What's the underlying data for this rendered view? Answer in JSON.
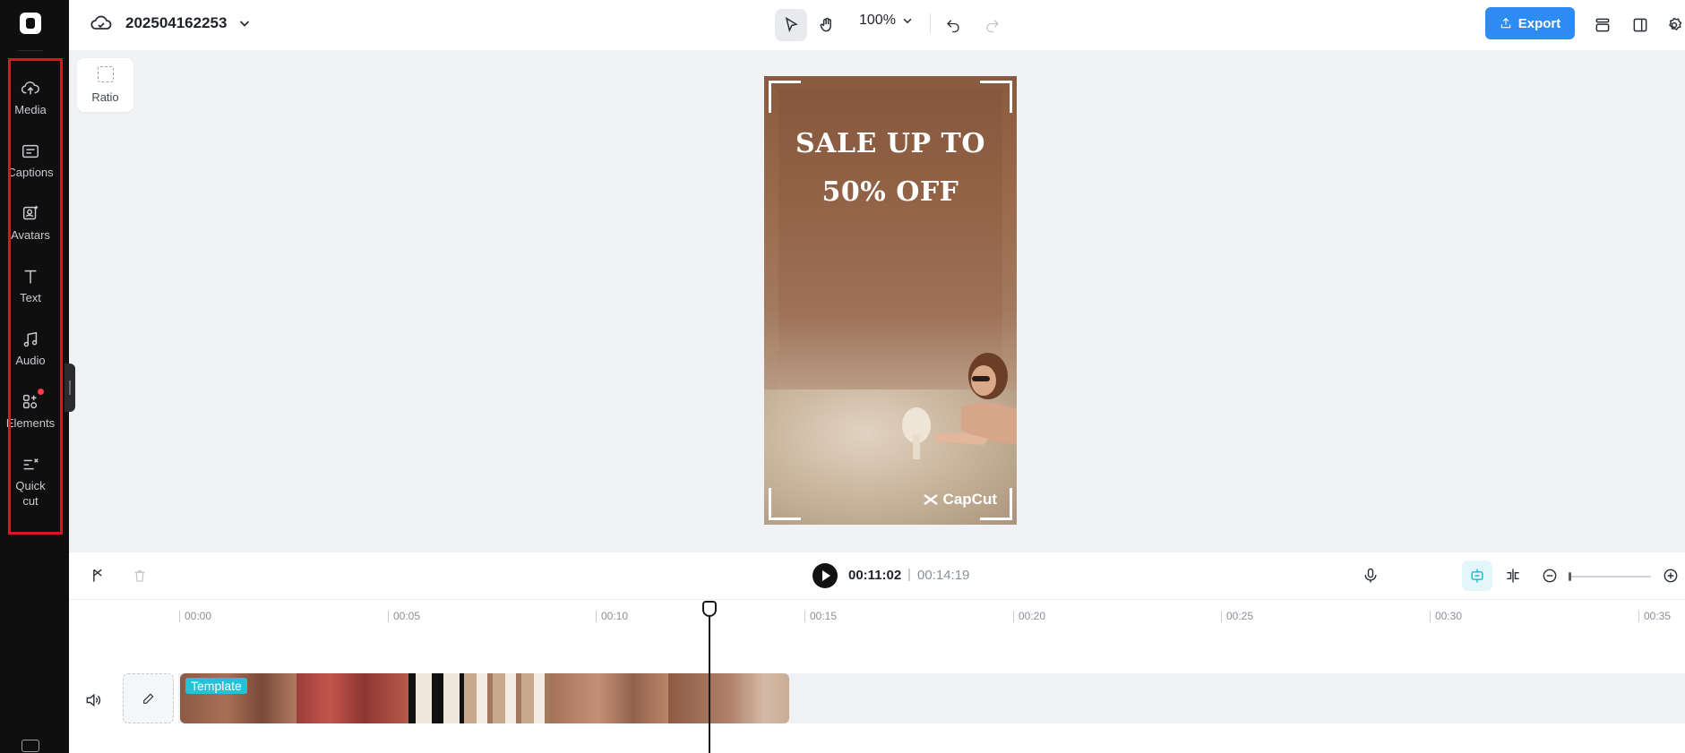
{
  "project": {
    "name": "202504162253"
  },
  "toolbar": {
    "zoom": "100%",
    "export_label": "Export"
  },
  "sidebar": {
    "items": [
      {
        "label": "Media",
        "icon": "cloud-upload-icon"
      },
      {
        "label": "Captions",
        "icon": "captions-icon"
      },
      {
        "label": "Avatars",
        "icon": "avatar-icon"
      },
      {
        "label": "Text",
        "icon": "text-icon"
      },
      {
        "label": "Audio",
        "icon": "music-note-icon"
      },
      {
        "label": "Elements",
        "icon": "elements-icon"
      },
      {
        "label": "Quick\ncut",
        "icon": "quick-cut-icon"
      }
    ]
  },
  "ratio": {
    "label": "Ratio"
  },
  "preview": {
    "line1": "SALE UP TO",
    "line2": "50% OFF",
    "brand": "CapCut"
  },
  "playback": {
    "current": "00:11:02",
    "separator": "|",
    "total": "00:14:19"
  },
  "timeline": {
    "ticks": [
      "00:00",
      "00:05",
      "00:10",
      "00:15",
      "00:20",
      "00:25",
      "00:30",
      "00:35"
    ],
    "clip_label": "Template"
  },
  "colors": {
    "accent": "#2f8bf4",
    "highlight": "#e0141e",
    "clip_tag": "#22c3d6"
  }
}
